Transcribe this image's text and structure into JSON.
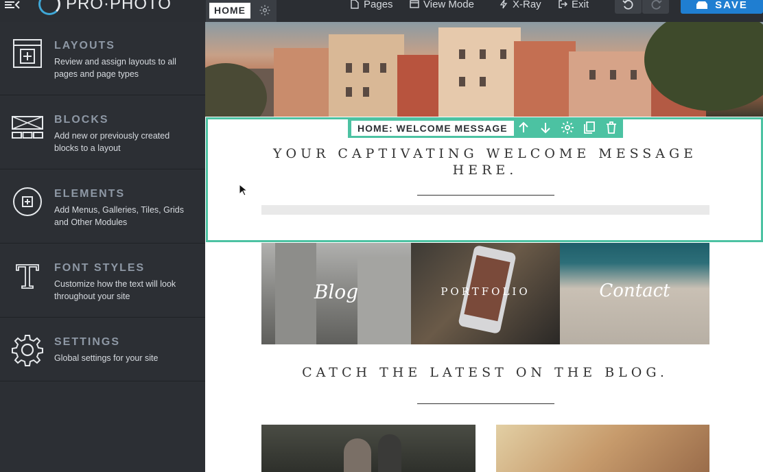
{
  "topbar": {
    "logo_text": "PRO·PHOTO",
    "current_page_tab": "HOME",
    "links": [
      {
        "label": "Pages",
        "icon": "page-icon"
      },
      {
        "label": "View Mode",
        "icon": "view-mode-icon"
      },
      {
        "label": "X-Ray",
        "icon": "xray-icon"
      },
      {
        "label": "Exit",
        "icon": "exit-icon"
      }
    ],
    "save_label": "SAVE"
  },
  "sidebar": {
    "items": [
      {
        "title": "LAYOUTS",
        "description": "Review and assign layouts to all pages and page types",
        "icon": "layouts-icon"
      },
      {
        "title": "BLOCKS",
        "description": "Add new or previously created blocks to a layout",
        "icon": "blocks-icon"
      },
      {
        "title": "ELEMENTS",
        "description": "Add Menus, Galleries, Tiles, Grids and Other Modules",
        "icon": "elements-icon"
      },
      {
        "title": "FONT STYLES",
        "description": "Customize how the text will look throughout your site",
        "icon": "font-styles-icon"
      },
      {
        "title": "SETTINGS",
        "description": "Global settings for your site",
        "icon": "settings-icon"
      }
    ]
  },
  "preview": {
    "block_label": "HOME: WELCOME MESSAGE",
    "welcome_title": "YOUR CAPTIVATING WELCOME MESSAGE HERE.",
    "tiles": [
      {
        "label": "Blog"
      },
      {
        "label": "PORTFOLIO"
      },
      {
        "label": "Contact"
      }
    ],
    "blog_heading": "CATCH THE LATEST ON THE BLOG."
  },
  "colors": {
    "accent_green": "#4cc2a2",
    "save_blue": "#1f7ed1",
    "sidebar_bg": "#2c2f34"
  }
}
